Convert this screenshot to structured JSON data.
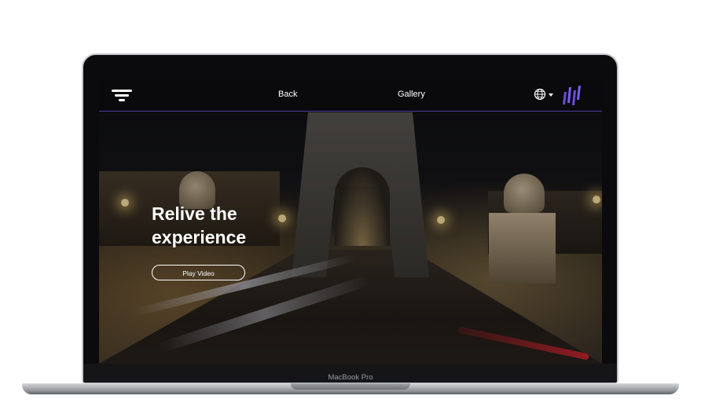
{
  "device": {
    "brand_label": "MacBook Pro"
  },
  "nav": {
    "back_label": "Back",
    "gallery_label": "Gallery",
    "language_icon": "globe-icon",
    "menu_icon": "filter-menu-icon",
    "brand_logo": "bars-logo",
    "accent_color": "#6a4dd8"
  },
  "hero": {
    "title_line1": "Relive the",
    "title_line2": "experience",
    "play_button_label": "Play Video"
  }
}
